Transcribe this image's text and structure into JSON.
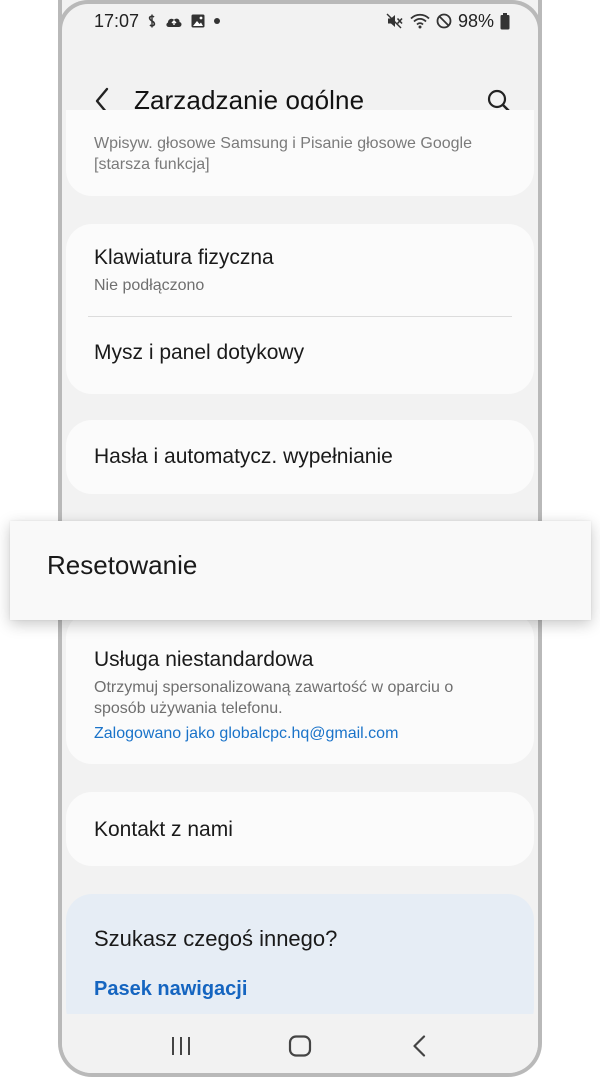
{
  "status_bar": {
    "time": "17:07",
    "battery": "98%"
  },
  "header": {
    "title": "Zarządzanie ogólne"
  },
  "partial_item": {
    "text_line1": "Wpisyw. głosowe Samsung i Pisanie głosowe Google",
    "text_line2": "[starsza funkcja]"
  },
  "keyboard_card": {
    "physical_keyboard_title": "Klawiatura fizyczna",
    "physical_keyboard_sub": "Nie podłączono",
    "mouse_title": "Mysz i panel dotykowy"
  },
  "passwords_item": {
    "title": "Hasła i automatycz. wypełnianie"
  },
  "highlight": {
    "label": "Resetowanie"
  },
  "service_item": {
    "title": "Usługa niestandardowa",
    "desc_line1": "Otrzymuj spersonalizowaną zawartość w oparciu o",
    "desc_line2": "sposób używania telefonu.",
    "account_link": "Zalogowano jako globalcpc.hq@gmail.com"
  },
  "contact_item": {
    "title": "Kontakt z nami"
  },
  "suggestion": {
    "title": "Szukasz czegoś innego?",
    "link": "Pasek nawigacji"
  },
  "icons": {
    "back": "back-arrow-icon",
    "search": "search-icon",
    "recents": "recents-icon",
    "home": "home-icon",
    "nav_back": "nav-back-icon"
  },
  "colors": {
    "link": "#1a73c9",
    "suggest_link": "#1565c0",
    "suggest_bg": "#e6edf5",
    "screen_bg": "#f2f2f2",
    "card_bg": "#fbfbfb"
  }
}
